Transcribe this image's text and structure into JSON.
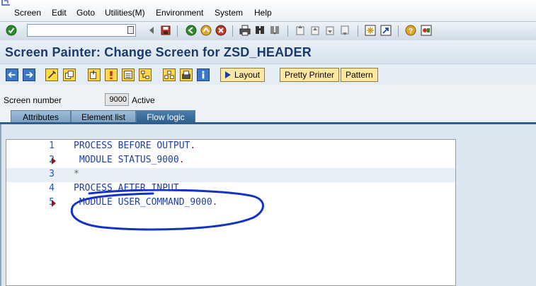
{
  "menu": {
    "items": [
      "Screen",
      "Edit",
      "Goto",
      "Utilities(M)",
      "Environment",
      "System",
      "Help"
    ]
  },
  "toolbar": {
    "command_value": ""
  },
  "title": "Screen Painter: Change Screen for ZSD_HEADER",
  "app_toolbar": {
    "layout_label": "Layout",
    "pretty_printer_label": "Pretty Printer",
    "pattern_label": "Pattern"
  },
  "screen": {
    "number_label": "Screen number",
    "number_value": "9000",
    "status": "Active"
  },
  "tabs": [
    {
      "label": "Attributes",
      "active": false
    },
    {
      "label": "Element list",
      "active": false
    },
    {
      "label": "Flow logic",
      "active": true
    }
  ],
  "code_lines": [
    {
      "num": "1",
      "text": "PROCESS BEFORE OUTPUT",
      "end": ".",
      "marked": false,
      "comment": false
    },
    {
      "num": "2",
      "text": " MODULE STATUS_9000",
      "end": ".",
      "marked": true,
      "comment": false
    },
    {
      "num": "3",
      "text": "*",
      "end": "",
      "marked": false,
      "comment": true
    },
    {
      "num": "4",
      "text": "PROCESS AFTER INPUT",
      "end": ".",
      "marked": false,
      "comment": false
    },
    {
      "num": "5",
      "text": " MODULE USER_COMMAND_9000",
      "end": ".",
      "marked": true,
      "comment": false
    }
  ],
  "colors": {
    "title": "#1b3a6b",
    "code_keyword": "#1f3f9f",
    "line_number": "#2a56b0",
    "marker": "#8b1a1a",
    "annotation": "#1432c8",
    "tab_active": "#2f5f8f"
  },
  "icons": {
    "toolbar": [
      "enter-icon",
      "back-icon",
      "save-icon",
      "go-back-icon",
      "exit-icon",
      "cancel-icon",
      "print-icon",
      "find-icon",
      "find-next-icon",
      "first-page-icon",
      "previous-page-icon",
      "next-page-icon",
      "last-page-icon",
      "new-session-icon",
      "shortcut-icon",
      "help-icon",
      "customize-icon"
    ]
  }
}
